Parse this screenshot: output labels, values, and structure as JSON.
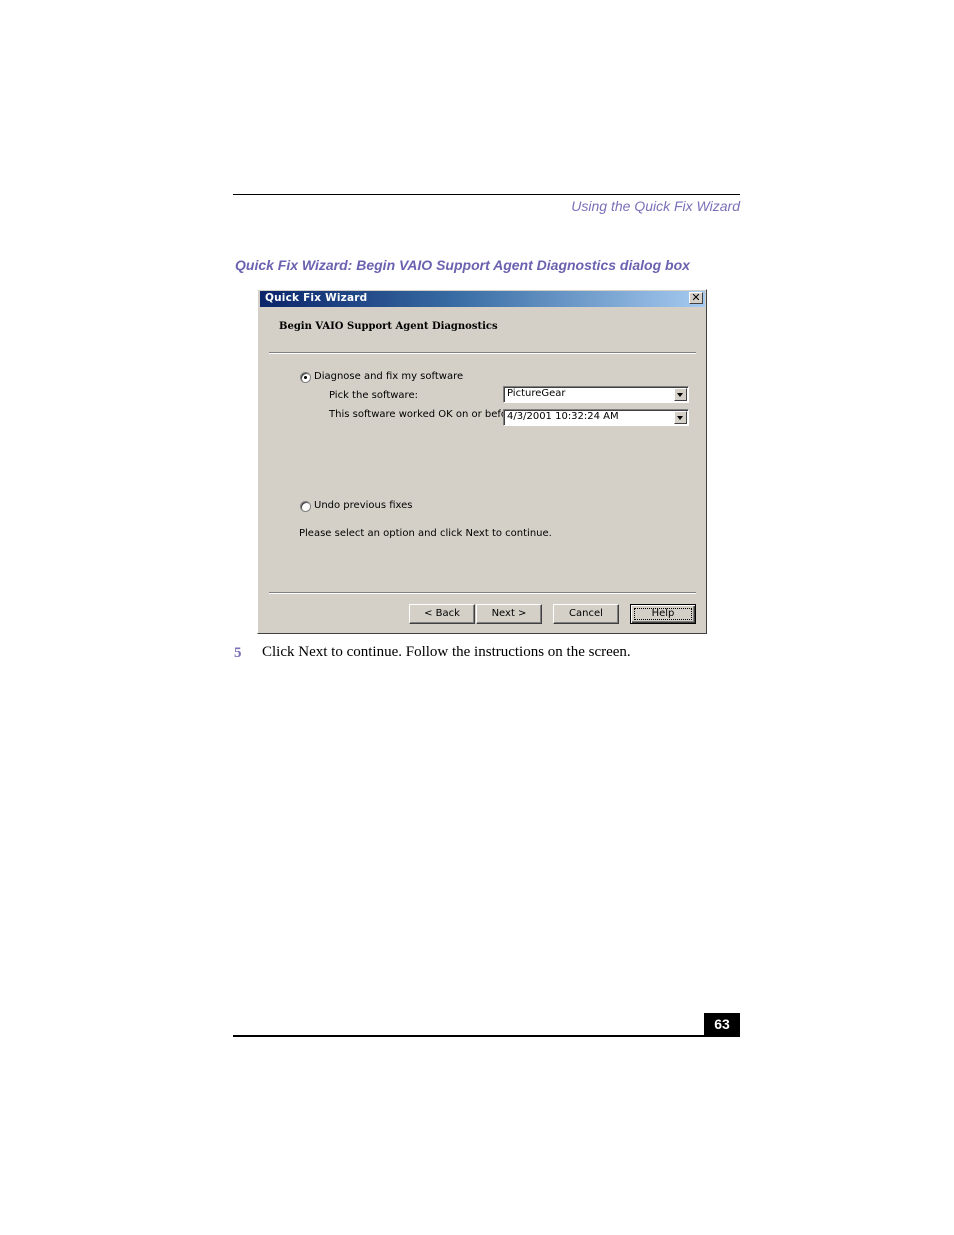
{
  "running_head": "Using the Quick Fix Wizard",
  "figure_caption": "Quick Fix Wizard: Begin VAIO Support Agent Diagnostics dialog box",
  "dialog": {
    "title": "Quick Fix Wizard",
    "close_glyph": "✕",
    "header": "Begin VAIO Support Agent Diagnostics",
    "option_diagnose": "Diagnose and fix my software",
    "pick_label": "Pick the software:",
    "software_value": "PictureGear",
    "worked_label": "This software worked OK on or before:",
    "date_value": "4/3/2001 10:32:24 AM",
    "option_undo": "Undo previous fixes",
    "instruction": "Please select an option  and click Next to continue.",
    "buttons": {
      "back": "< Back",
      "next": "Next >",
      "cancel": "Cancel",
      "help": "Help"
    }
  },
  "step": {
    "number": "5",
    "text": "Click Next to continue. Follow the instructions on the screen."
  },
  "page_number": "63"
}
